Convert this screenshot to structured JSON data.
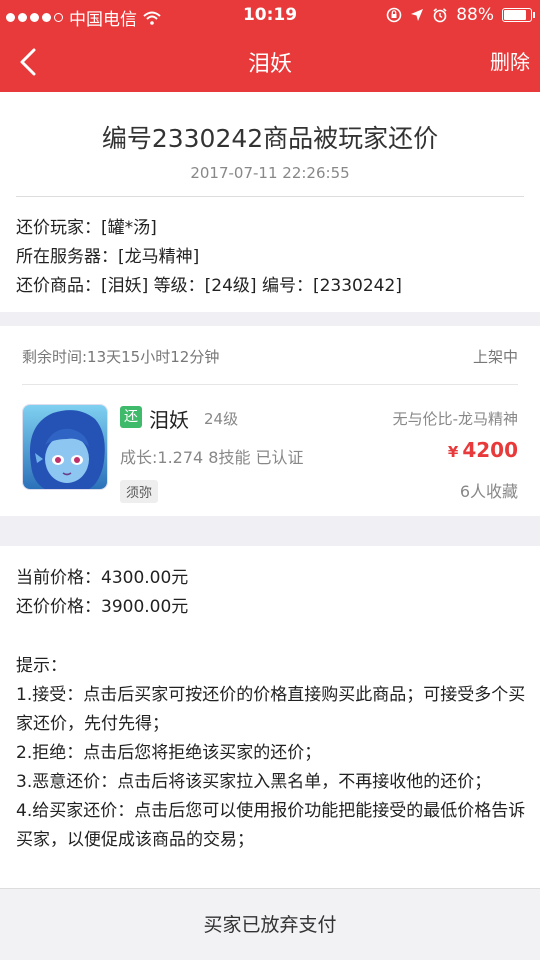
{
  "status_bar": {
    "carrier": "中国电信",
    "time": "10:19",
    "battery": "88%",
    "battery_level": 0.88
  },
  "nav": {
    "title": "泪妖",
    "action": "删除"
  },
  "message": {
    "title": "编号2330242商品被玩家还价",
    "time": "2017-07-11 22:26:55",
    "lines": [
      "还价玩家：[罐*汤]",
      "所在服务器：[龙马精神]",
      "还价商品：[泪妖] 等级：[24级] 编号：[2330242]"
    ]
  },
  "listing": {
    "remaining": "剩余时间:13天15小时12分钟",
    "status": "上架中",
    "tag": "还",
    "name": "泪妖",
    "level": "24级",
    "server": "无与伦比-龙马精神",
    "stats": "成长:1.274 8技能 已认证",
    "currency": "¥",
    "price": "4200",
    "school": "须弥",
    "favorites": "6人收藏"
  },
  "prices": {
    "current": "当前价格：4300.00元",
    "counter": "还价价格：3900.00元"
  },
  "tips": [
    "提示：",
    "1.接受：点击后买家可按还价的价格直接购买此商品；可接受多个买家还价，先付先得；",
    "2.拒绝：点击后您将拒绝该买家的还价；",
    "3.恶意还价：点击后将该买家拉入黑名单，不再接收他的还价；",
    "4.给买家还价：点击后您可以使用报价功能把能接受的最低价格告诉买家，以便促成该商品的交易；"
  ],
  "bottom": {
    "label": "买家已放弃支付"
  },
  "colors": {
    "brand_red": "#e83a3a",
    "tag_green": "#3fb96a"
  }
}
